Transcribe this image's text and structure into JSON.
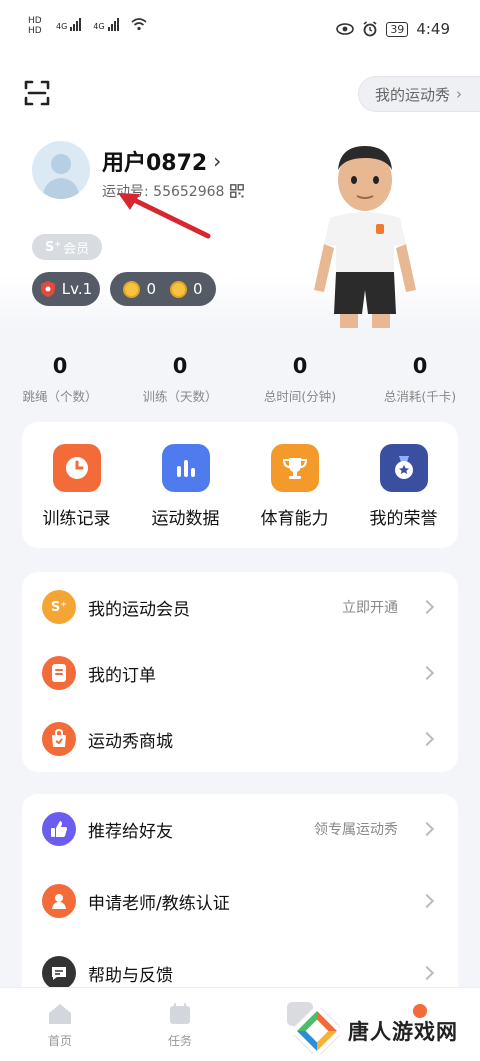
{
  "status_bar": {
    "left_top": "HD",
    "left_bottom": "HD",
    "sig1": "4G",
    "sig2": "4G",
    "battery": "39",
    "time": "4:49"
  },
  "header": {
    "my_show_label": "我的运动秀",
    "username": "用户0872",
    "sport_id": "运动号: 55652968",
    "member_label": "会员",
    "member_prefix": "S⁺",
    "level": "Lv.1",
    "coin1": "0",
    "coin2": "0"
  },
  "stats": [
    {
      "value": "0",
      "label": "跳绳（个数）"
    },
    {
      "value": "0",
      "label": "训练（天数）"
    },
    {
      "value": "0",
      "label": "总时间(分钟)"
    },
    {
      "value": "0",
      "label": "总消耗(千卡)"
    }
  ],
  "grid": [
    {
      "label": "训练记录",
      "icon": "clock-icon",
      "color": "#f26b38"
    },
    {
      "label": "运动数据",
      "icon": "bar-chart-icon",
      "color": "#4f7bef"
    },
    {
      "label": "体育能力",
      "icon": "trophy-icon",
      "color": "#f39a2b"
    },
    {
      "label": "我的荣誉",
      "icon": "medal-icon",
      "color": "#3a4fa0"
    }
  ],
  "menu1": [
    {
      "label": "我的运动会员",
      "extra": "立即开通",
      "icon": "vip-icon",
      "color": "#f4a534"
    },
    {
      "label": "我的订单",
      "extra": "",
      "icon": "order-icon",
      "color": "#f26b38"
    },
    {
      "label": "运动秀商城",
      "extra": "",
      "icon": "shop-icon",
      "color": "#f26b38"
    }
  ],
  "menu2": [
    {
      "label": "推荐给好友",
      "extra": "领专属运动秀",
      "icon": "thumbs-up-icon",
      "color": "#6a5df0"
    },
    {
      "label": "申请老师/教练认证",
      "extra": "",
      "icon": "user-icon",
      "color": "#f26b38"
    },
    {
      "label": "帮助与反馈",
      "extra": "",
      "icon": "chat-icon",
      "color": "#333333"
    }
  ],
  "tabs": [
    {
      "label": "首页"
    },
    {
      "label": "任务"
    },
    {
      "label": ""
    },
    {
      "label": ""
    }
  ],
  "watermark": "唐人游戏网"
}
